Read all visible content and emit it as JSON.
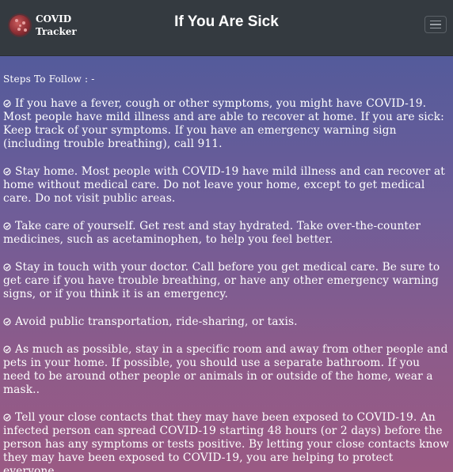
{
  "navbar": {
    "brand_line1": "COVID",
    "brand_line2": "Tracker",
    "title": "If You Are Sick",
    "menu_icon": "hamburger-icon"
  },
  "content": {
    "heading": "Steps To Follow : -",
    "steps": [
      "If you have a fever, cough or other symptoms, you might have COVID-19. Most people have mild illness and are able to recover at home. If you are sick: Keep track of your symptoms. If you have an emergency warning sign (including trouble breathing), call 911.",
      "Stay home. Most people with COVID-19 have mild illness and can recover at home without medical care. Do not leave your home, except to get medical care. Do not visit public areas.",
      "Take care of yourself. Get rest and stay hydrated. Take over-the-counter medicines, such as acetaminophen, to help you feel better.",
      "Stay in touch with your doctor. Call before you get medical care. Be sure to get care if you have trouble breathing, or have any other emergency warning signs, or if you think it is an emergency.",
      "Avoid public transportation, ride-sharing, or taxis.",
      "As much as possible, stay in a specific room and away from other people and pets in your home. If possible, you should use a separate bathroom. If you need to be around other people or animals in or outside of the home, wear a mask..",
      "Tell your close contacts that they may have been exposed to COVID-19. An infected person can spread COVID-19 starting 48 hours (or 2 days) before the person has any symptoms or tests positive. By letting your close contacts know they may have been exposed to COVID-19, you are helping to protect everyone."
    ],
    "step_icon": "check-circle-icon"
  }
}
